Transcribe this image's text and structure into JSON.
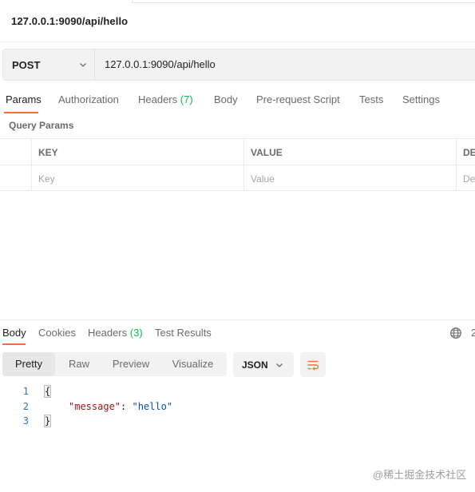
{
  "request": {
    "title": "127.0.0.1:9090/api/hello",
    "method": "POST",
    "url": "127.0.0.1:9090/api/hello"
  },
  "request_tabs": {
    "params": "Params",
    "authorization": "Authorization",
    "headers": "Headers",
    "headers_count": "(7)",
    "body": "Body",
    "prerequest": "Pre-request Script",
    "tests": "Tests",
    "settings": "Settings"
  },
  "query_params": {
    "label": "Query Params",
    "columns": [
      "KEY",
      "VALUE",
      "DE"
    ],
    "placeholders": [
      "Key",
      "Value",
      "De"
    ]
  },
  "response_tabs": {
    "body": "Body",
    "cookies": "Cookies",
    "headers": "Headers",
    "headers_count": "(3)",
    "test_results": "Test Results",
    "status_digit": "2"
  },
  "view": {
    "modes": [
      "Pretty",
      "Raw",
      "Preview",
      "Visualize"
    ],
    "format": "JSON"
  },
  "code": {
    "line_numbers": [
      "1",
      "2",
      "3"
    ],
    "open_brace": "{",
    "key": "\"message\"",
    "colon": ": ",
    "value": "\"hello\"",
    "close_brace": "}"
  },
  "watermark": "@稀土掘金技术社区",
  "colors": {
    "accent": "#ff6c37",
    "count_green": "#0cbb52",
    "json_key": "#a31515",
    "json_string": "#0451a5",
    "line_number": "#2b75b8"
  },
  "icons": [
    "chevron-down-icon",
    "globe-icon",
    "wrap-lines-icon"
  ]
}
